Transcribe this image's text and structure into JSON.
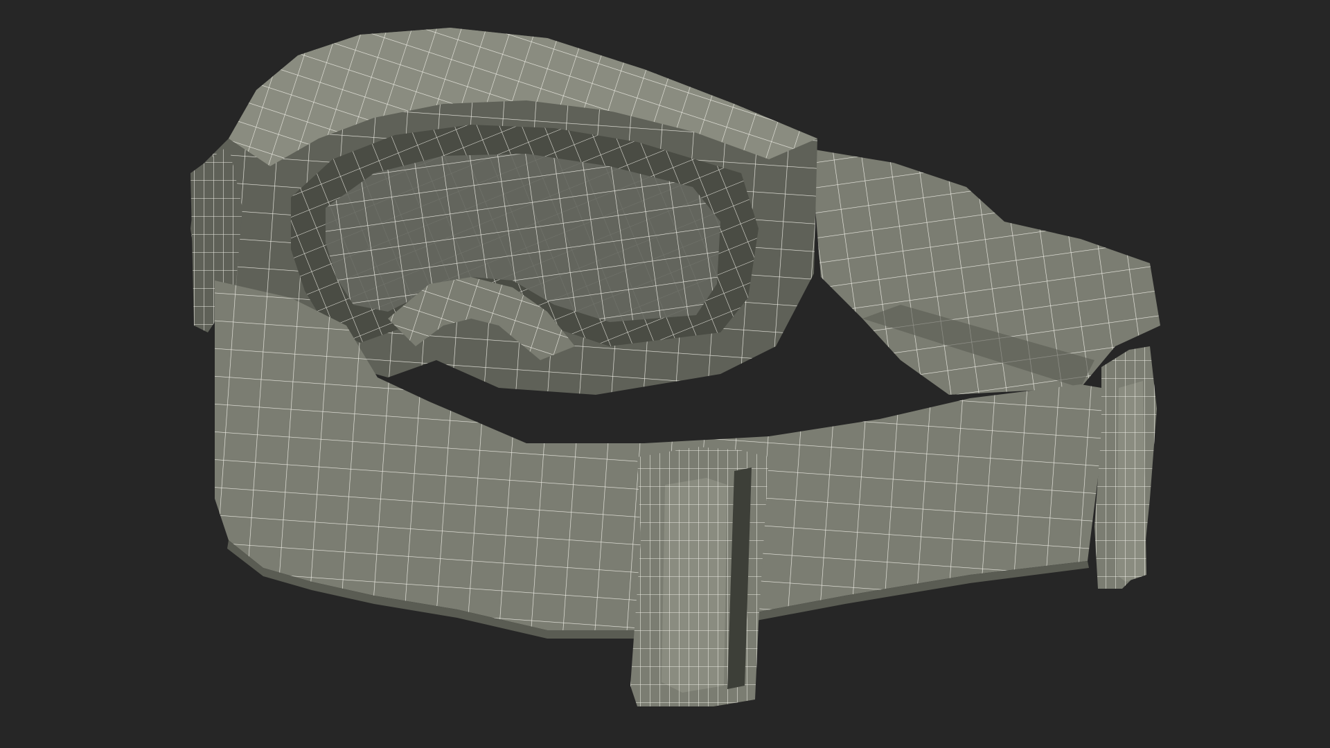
{
  "scene": {
    "subject": "goggles-wireframe-render",
    "colors": {
      "background": "#262626",
      "surface": "#7b7d72",
      "surface_dark": "#5f6158",
      "surface_shadow": "#4a4c44",
      "surface_light": "#8a8c80",
      "wire": "#efeee6"
    }
  }
}
